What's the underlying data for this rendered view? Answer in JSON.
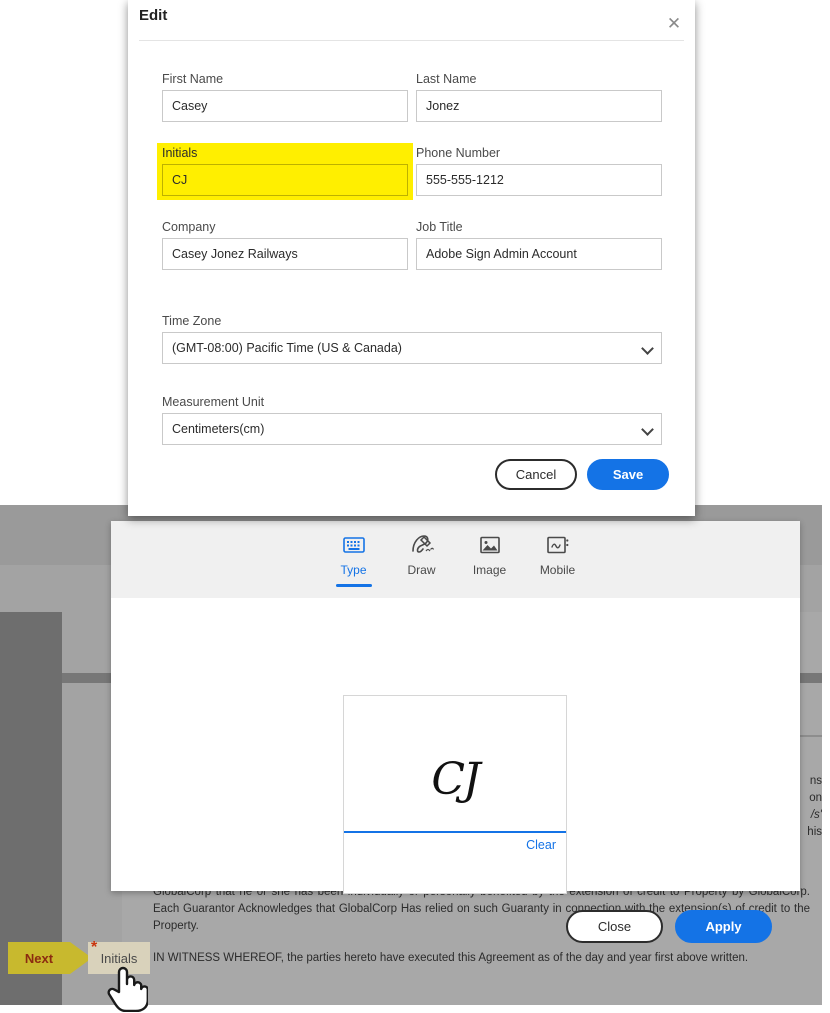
{
  "edit_modal": {
    "title": "Edit",
    "close_icon": "close-icon",
    "fields": {
      "first_name": {
        "label": "First Name",
        "value": "Casey",
        "placeholder": ""
      },
      "last_name": {
        "label": "Last Name",
        "value": "Jonez",
        "placeholder": ""
      },
      "initials": {
        "label": "Initials",
        "value": "CJ",
        "placeholder": "",
        "highlighted": true,
        "highlight_color": "#ffef00"
      },
      "phone_number": {
        "label": "Phone Number",
        "value": "555-555-1212",
        "placeholder": ""
      },
      "company": {
        "label": "Company",
        "value": "Casey Jonez Railways",
        "placeholder": ""
      },
      "job_title": {
        "label": "Job Title",
        "value": "Adobe Sign Admin Account",
        "placeholder": ""
      },
      "time_zone": {
        "label": "Time Zone",
        "value": "(GMT-08:00) Pacific Time (US & Canada)",
        "options": [
          "(GMT-08:00) Pacific Time (US & Canada)"
        ]
      },
      "measurement_unit": {
        "label": "Measurement Unit",
        "value": "Centimeters(cm)",
        "options": [
          "Centimeters(cm)"
        ]
      }
    },
    "cancel_label": "Cancel",
    "save_label": "Save"
  },
  "signature_panel": {
    "tabs": [
      {
        "label": "Type",
        "icon": "keyboard-icon",
        "active": true
      },
      {
        "label": "Draw",
        "icon": "pen-icon",
        "active": false
      },
      {
        "label": "Image",
        "icon": "image-icon",
        "active": false
      },
      {
        "label": "Mobile",
        "icon": "mobile-signature-icon",
        "active": false
      }
    ],
    "signature_text": "CJ",
    "clear_label": "Clear",
    "close_label": "Close",
    "apply_label": "Apply",
    "accent_color": "#1473e6"
  },
  "document": {
    "paragraph_1": "GlobalCorp that he or she has been individually or personally benefited by the extension of credit to Property by GlobalCorp. Each Guarantor Acknowledges that GlobalCorp Has relied on such Guaranty in connection with the extension(s) of credit to the Property.",
    "paragraph_2": "IN WITNESS WHEREOF, the parties hereto have executed this Agreement as of the day and year first above written.",
    "edge_fragments": [
      "ns",
      "on",
      "/s'",
      "his",
      "to",
      "erty by",
      "h  the"
    ]
  },
  "field_strip": {
    "next_label": "Next",
    "initials_label": "Initials",
    "required_marker": "*",
    "next_color": "#c8b92e",
    "next_text_color": "#8c2b10",
    "initials_bg": "#d9d2bb"
  }
}
